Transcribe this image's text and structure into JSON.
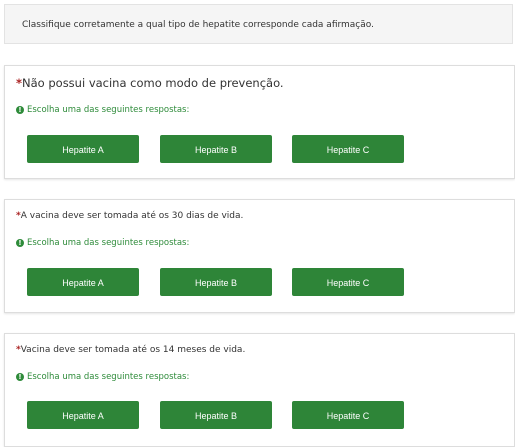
{
  "instructions": "Classifique corretamente a qual tipo de hepatite corresponde cada afirmação.",
  "questions": [
    {
      "text": "Não possui vacina como modo de prevenção.",
      "hint": "Escolha uma das seguintes respostas:",
      "options": [
        "Hepatite A",
        "Hepatite B",
        "Hepatite C"
      ]
    },
    {
      "text": "A vacina deve ser tomada até os 30 dias de vida.",
      "hint": "Escolha uma das seguintes respostas:",
      "options": [
        "Hepatite A",
        "Hepatite B",
        "Hepatite C"
      ]
    },
    {
      "text": "Vacina deve ser tomada até os 14 meses de vida.",
      "hint": "Escolha uma das seguintes respostas:",
      "options": [
        "Hepatite A",
        "Hepatite B",
        "Hepatite C"
      ]
    }
  ],
  "required_mark": "*",
  "hint_icon": "!",
  "colors": {
    "accent": "#2e8538",
    "required": "#a22"
  }
}
